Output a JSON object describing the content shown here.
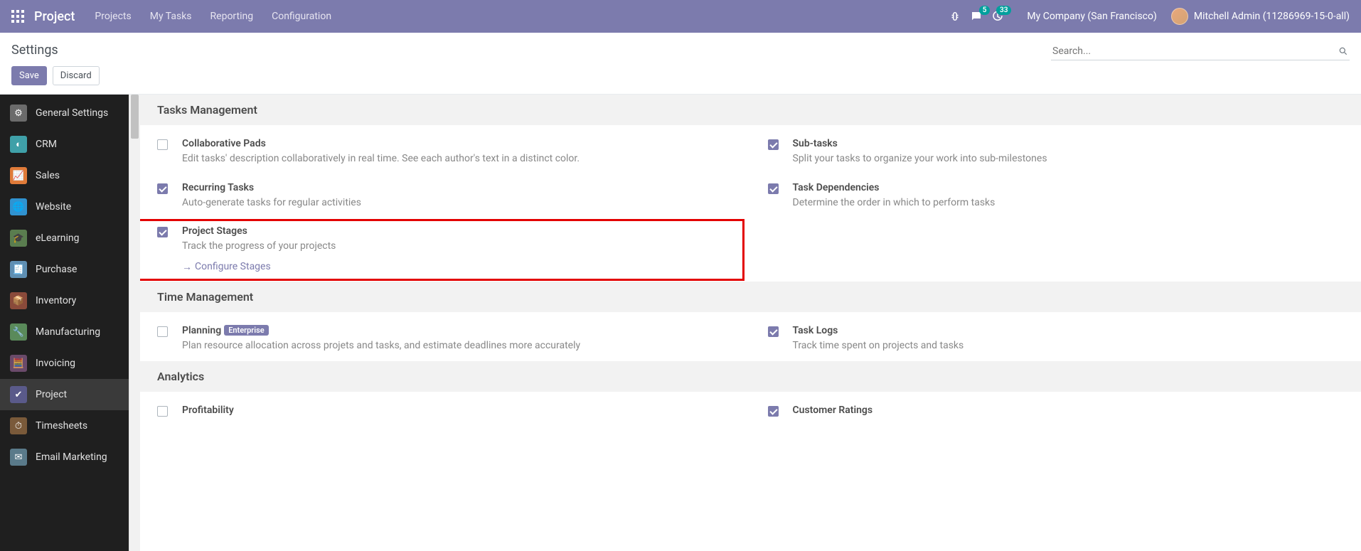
{
  "navbar": {
    "brand": "Project",
    "links": [
      "Projects",
      "My Tasks",
      "Reporting",
      "Configuration"
    ],
    "messages_badge": "5",
    "activities_badge": "33",
    "company": "My Company (San Francisco)",
    "user": "Mitchell Admin (11286969-15-0-all)"
  },
  "control": {
    "title": "Settings",
    "save": "Save",
    "discard": "Discard",
    "search_placeholder": "Search..."
  },
  "sidebar": [
    {
      "label": "General Settings",
      "color": "#6b6b6b",
      "glyph": "⚙"
    },
    {
      "label": "CRM",
      "color": "#3fa0a8",
      "glyph": "◐"
    },
    {
      "label": "Sales",
      "color": "#e07b39",
      "glyph": "📈"
    },
    {
      "label": "Website",
      "color": "#3093d1",
      "glyph": "🌐"
    },
    {
      "label": "eLearning",
      "color": "#5a7d4f",
      "glyph": "🎓"
    },
    {
      "label": "Purchase",
      "color": "#5f8fb3",
      "glyph": "🧾"
    },
    {
      "label": "Inventory",
      "color": "#8a4a3a",
      "glyph": "📦"
    },
    {
      "label": "Manufacturing",
      "color": "#5a8a5a",
      "glyph": "🔧"
    },
    {
      "label": "Invoicing",
      "color": "#6a4a6a",
      "glyph": "🧮"
    },
    {
      "label": "Project",
      "color": "#5a5a8a",
      "glyph": "✔",
      "active": true
    },
    {
      "label": "Timesheets",
      "color": "#7a5a3a",
      "glyph": "⏱"
    },
    {
      "label": "Email Marketing",
      "color": "#5a7a8a",
      "glyph": "✉"
    }
  ],
  "sections": [
    {
      "title": "Tasks Management",
      "settings": [
        {
          "title": "Collaborative Pads",
          "desc": "Edit tasks' description collaboratively in real time. See each author's text in a distinct color.",
          "checked": false
        },
        {
          "title": "Sub-tasks",
          "desc": "Split your tasks to organize your work into sub-milestones",
          "checked": true
        },
        {
          "title": "Recurring Tasks",
          "desc": "Auto-generate tasks for regular activities",
          "checked": true
        },
        {
          "title": "Task Dependencies",
          "desc": "Determine the order in which to perform tasks",
          "checked": true
        },
        {
          "title": "Project Stages",
          "desc": "Track the progress of your projects",
          "checked": true,
          "link": "Configure Stages",
          "highlighted": true
        }
      ]
    },
    {
      "title": "Time Management",
      "settings": [
        {
          "title": "Planning",
          "desc": "Plan resource allocation across projets and tasks, and estimate deadlines more accurately",
          "checked": false,
          "enterprise": "Enterprise"
        },
        {
          "title": "Task Logs",
          "desc": "Track time spent on projects and tasks",
          "checked": true
        }
      ]
    },
    {
      "title": "Analytics",
      "settings": [
        {
          "title": "Profitability",
          "desc": "",
          "checked": false
        },
        {
          "title": "Customer Ratings",
          "desc": "",
          "checked": true
        }
      ]
    }
  ]
}
